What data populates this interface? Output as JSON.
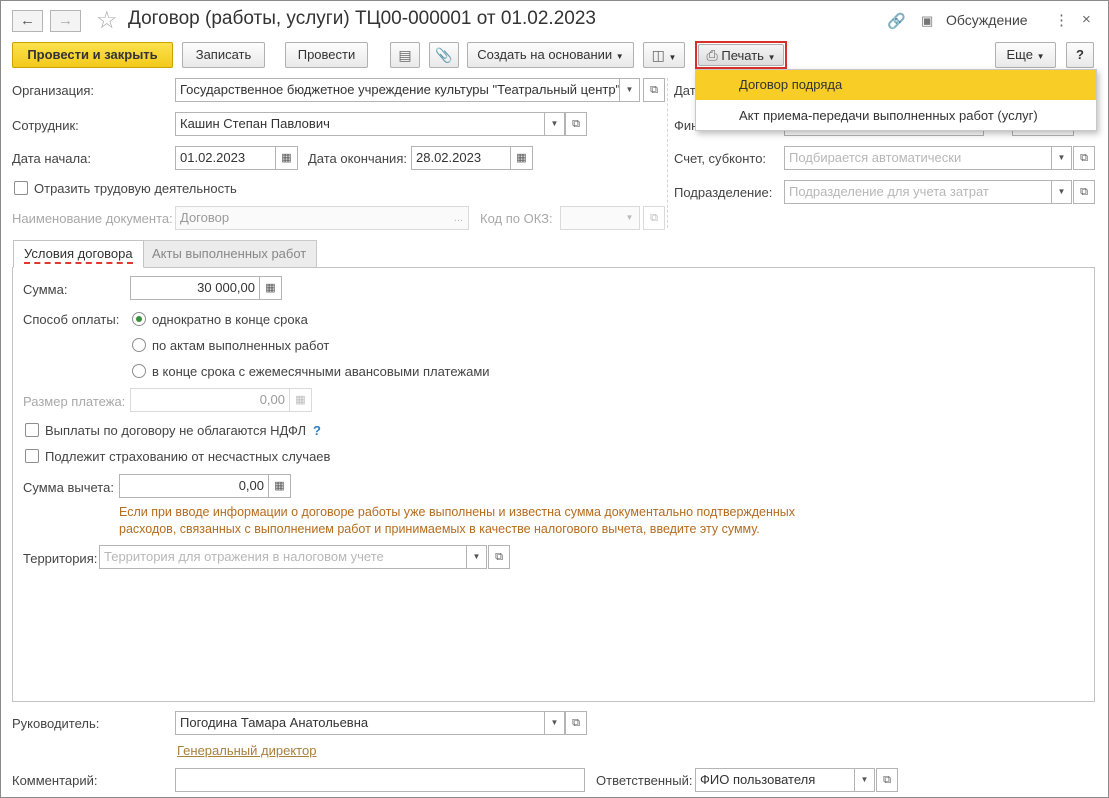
{
  "window": {
    "title": "Договор (работы, услуги) ТЦ00-000001 от 01.02.2023",
    "discussion_label": "Обсуждение"
  },
  "toolbar": {
    "post_close": "Провести и закрыть",
    "save": "Записать",
    "post": "Провести",
    "create_based": "Создать на основании",
    "print": "Печать",
    "more": "Еще",
    "help": "?"
  },
  "print_menu": {
    "items": [
      "Договор подряда",
      "Акт приема-передачи выполненных работ (услуг)"
    ]
  },
  "form": {
    "org_label": "Организация:",
    "org_value": "Государственное бюджетное учреждение культуры \"Театральный центр\"",
    "employee_label": "Сотрудник:",
    "employee_value": "Кашин Степан Павлович",
    "start_label": "Дата начала:",
    "start_value": "01.02.2023",
    "end_label": "Дата окончания:",
    "end_value": "28.02.2023",
    "reflect_label": "Отразить трудовую деятельность",
    "docname_label": "Наименование документа:",
    "docname_value": "Договор",
    "okz_label": "Код по ОКЗ:",
    "right_date_label": "Дат",
    "right_fin_label": "Фин",
    "account_label": "Счет, субконто:",
    "account_placeholder": "Подбирается автоматически",
    "dept_label": "Подразделение:",
    "dept_placeholder": "Подразделение для учета затрат"
  },
  "tabs": {
    "conditions": "Условия договора",
    "acts": "Акты выполненных работ"
  },
  "conditions": {
    "sum_label": "Сумма:",
    "sum_value": "30 000,00",
    "pay_method_label": "Способ оплаты:",
    "pay_options": [
      "однократно в конце срока",
      "по актам выполненных работ",
      "в конце срока с ежемесячными авансовыми платежами"
    ],
    "payment_size_label": "Размер платежа:",
    "payment_size_value": "0,00",
    "ndfl_label": "Выплаты по договору не облагаются НДФЛ",
    "ndfl_help": "?",
    "insurance_label": "Подлежит страхованию от несчастных случаев",
    "deduction_label": "Сумма вычета:",
    "deduction_value": "0,00",
    "deduction_hint": "Если при вводе информации о договоре работы уже выполнены и известна сумма документально подтвержденных расходов, связанных с выполнением работ и принимаемых в качестве налогового вычета, введите эту сумму.",
    "territory_label": "Территория:",
    "territory_placeholder": "Территория для отражения в налоговом учете"
  },
  "footer": {
    "head_label": "Руководитель:",
    "head_value": "Погодина Тамара Анатольевна",
    "head_position": "Генеральный директор",
    "comment_label": "Комментарий:",
    "comment_value": "",
    "responsible_label": "Ответственный:",
    "responsible_value": "ФИО пользователя"
  }
}
